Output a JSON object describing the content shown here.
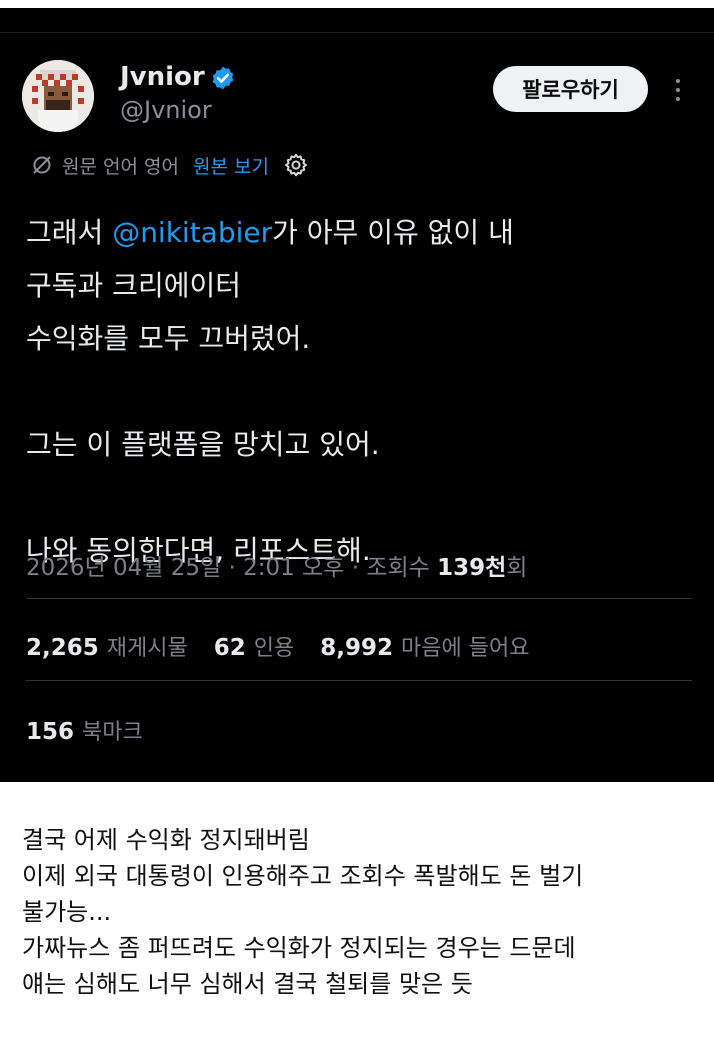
{
  "tweet": {
    "display_name": "Jvnior",
    "handle": "@Jvnior",
    "follow_label": "팔로우하기",
    "translate_note": "원문 언어 영어",
    "view_original_label": "원본 보기",
    "body": {
      "line1_before": "그래서 ",
      "mention": "@nikitabier",
      "line1_after": "가 아무 이유 없이 내",
      "line2": "구독과 크리에이터",
      "line3": "수익화를 모두 끄버렸어.",
      "line4": "그는 이 플랫폼을 망치고 있어.",
      "line5": "나와 동의한다면, 리포스트해."
    },
    "meta": {
      "datetime": "2026년 04월 25일 · 2:01 오후 · 조회수 ",
      "views_value": "139천",
      "views_suffix": "회"
    },
    "stats": {
      "reposts_value": "2,265",
      "reposts_label": "재게시물",
      "quotes_value": "62",
      "quotes_label": "인용",
      "likes_value": "8,992",
      "likes_label": "마음에 들어요",
      "bookmarks_value": "156",
      "bookmarks_label": "북마크"
    },
    "colors": {
      "background": "#000000",
      "link": "#1d9bf0",
      "verified": "#1d9bf0",
      "muted": "#7b8086"
    },
    "icons": [
      "verified-badge-icon",
      "more-options-icon",
      "translate-icon",
      "settings-gear-icon",
      "avatar-image"
    ]
  },
  "caption": {
    "lines": [
      "결국 어제 수익화 정지돼버림",
      "이제 외국 대통령이 인용해주고 조회수 폭발해도 돈 벌기",
      "불가능...",
      "가짜뉴스 좀 퍼뜨려도 수익화가 정지되는 경우는 드문데",
      "얘는 심해도 너무 심해서 결국 철퇴를 맞은 듯"
    ]
  }
}
